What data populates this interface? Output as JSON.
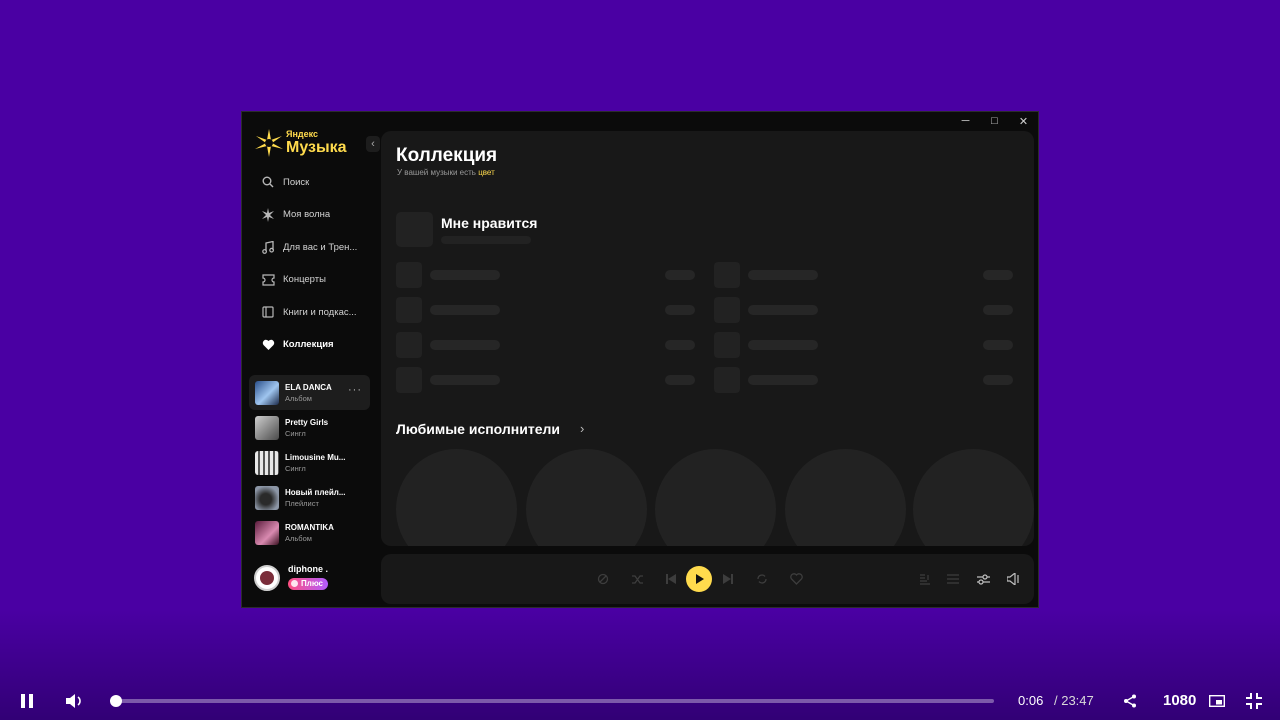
{
  "app": {
    "window_controls": {
      "minimize": "─",
      "maximize": "□",
      "close": "✕"
    },
    "logo": {
      "small": "Яндекс",
      "big": "Музыка",
      "icon": "yandex-music-star-icon"
    },
    "collapse_label": "‹",
    "nav": [
      {
        "label": "Поиск",
        "icon": "search-icon"
      },
      {
        "label": "Моя волна",
        "icon": "wave-icon"
      },
      {
        "label": "Для вас и Трен...",
        "icon": "music-note-icon"
      },
      {
        "label": "Концерты",
        "icon": "ticket-icon"
      },
      {
        "label": "Книги и подкас...",
        "icon": "book-icon"
      },
      {
        "label": "Коллекция",
        "icon": "heart-icon",
        "active": true
      }
    ],
    "library": [
      {
        "title": "ELA DANCA",
        "subtitle": "Альбом",
        "color": "#3f6aa0"
      },
      {
        "title": "Pretty Girls",
        "subtitle": "Сингл",
        "color": "#8a8a8a"
      },
      {
        "title": "Limousine Mu...",
        "subtitle": "Сингл",
        "color": "#cfcfcf"
      },
      {
        "title": "Новый плейл...",
        "subtitle": "Плейлист",
        "color": "#5c6470"
      },
      {
        "title": "ROMANTIKA",
        "subtitle": "Альбом",
        "color": "#8a3a6a"
      }
    ],
    "library_more": "···",
    "profile": {
      "username": "diphone .",
      "badge": "Плюс"
    },
    "main": {
      "title": "Коллекция",
      "subtitle_prefix": "У вашей музыки есть ",
      "subtitle_accent": "цвет",
      "likes_title": "Мне нравится",
      "artists_title": "Любимые исполнители",
      "artists_chevron": "›"
    },
    "player": {
      "buttons": [
        "dislike-icon",
        "shuffle-icon",
        "previous-icon",
        "play-icon",
        "next-icon",
        "repeat-icon",
        "like-icon",
        "lyrics-icon",
        "queue-icon",
        "settings-icon",
        "volume-icon"
      ]
    }
  },
  "video_player": {
    "time_current": "0:06",
    "time_total": "/ 23:47",
    "quality": "1080",
    "progress": 0.004
  },
  "colors": {
    "background": "#4a00a3",
    "accent": "#ffdb4d"
  }
}
